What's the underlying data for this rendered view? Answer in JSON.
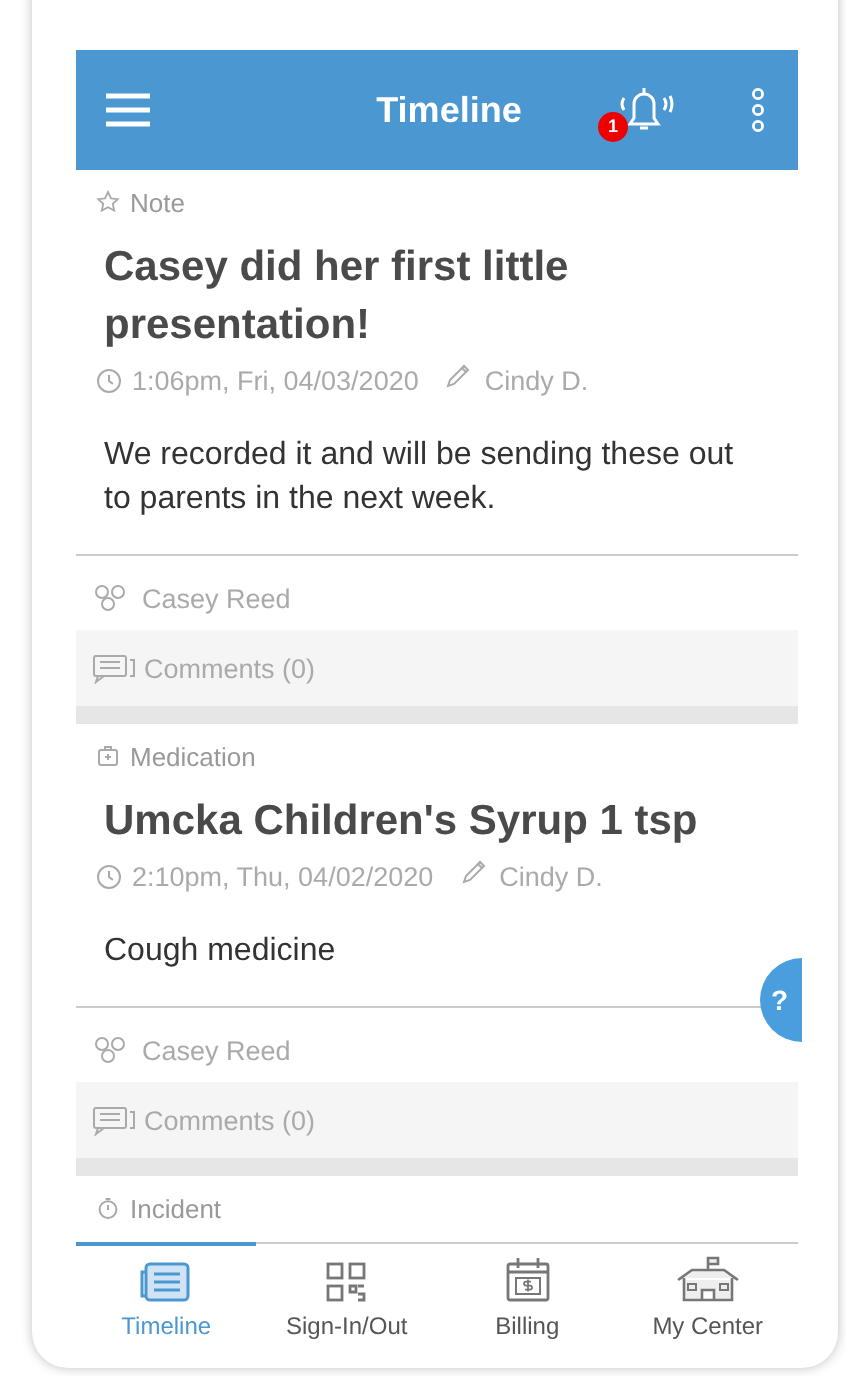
{
  "header": {
    "title": "Timeline",
    "notification_count": "1"
  },
  "entries": [
    {
      "kind": "note",
      "category": "Note",
      "title": "Casey did her first little presentation!",
      "time": "1:06pm, Fri, 04/03/2020",
      "author": "Cindy D.",
      "body": "We recorded it and will be sending these out to parents in the next week.",
      "child": "Casey Reed",
      "comments": "Comments (0)"
    },
    {
      "kind": "medication",
      "category": "Medication",
      "title": "Umcka Children's Syrup 1 tsp",
      "time": "2:10pm, Thu, 04/02/2020",
      "author": "Cindy D.",
      "body": "Cough medicine",
      "child": "Casey Reed",
      "comments": "Comments (0)"
    },
    {
      "kind": "incident",
      "category": "Incident"
    }
  ],
  "help_button": {
    "label": "?"
  },
  "tabs": [
    {
      "kind": "timeline",
      "label": "Timeline",
      "selected": true
    },
    {
      "kind": "signin",
      "label": "Sign-In/Out",
      "selected": false
    },
    {
      "kind": "billing",
      "label": "Billing",
      "selected": false
    },
    {
      "kind": "center",
      "label": "My Center",
      "selected": false
    }
  ]
}
